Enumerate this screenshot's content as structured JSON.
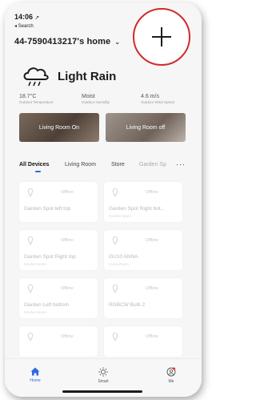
{
  "status": {
    "time": "14:06",
    "back_label": "◂ Search"
  },
  "home": {
    "title": "44-7590413217's home",
    "chevron": "⌄"
  },
  "weather": {
    "condition": "Light Rain",
    "temperature": "18.7°C",
    "temperature_label": "Outdoor Temperature",
    "humidity": "Moist",
    "humidity_label": "Outdoor Humidity",
    "wind": "4.6 m/s",
    "wind_label": "Outdoor Wind Speed"
  },
  "scenes": [
    "Living Room On",
    "Living Room off"
  ],
  "tabs": [
    "All Devices",
    "Living Room",
    "Store",
    "Garden Sp",
    "···"
  ],
  "devices": [
    {
      "status": "Offline",
      "name": "Garden Spot left top",
      "room": ""
    },
    {
      "status": "Offline",
      "name": "Garden Spot Right bot...",
      "room": "Garden Spots"
    },
    {
      "status": "Offline",
      "name": "Garden Spot Right top",
      "room": "Garden Spots"
    },
    {
      "status": "Offline",
      "name": "GU10 ANNA",
      "room": "Living Room"
    },
    {
      "status": "Offline",
      "name": "Garden Left bottom",
      "room": "Garden Spots"
    },
    {
      "status": "Offline",
      "name": "RGBCW Bulb 2",
      "room": ""
    },
    {
      "status": "Offline",
      "name": "",
      "room": ""
    },
    {
      "status": "Offline",
      "name": "",
      "room": ""
    }
  ],
  "nav": [
    "Home",
    "Smart",
    "Me"
  ],
  "colors": {
    "accent": "#2f6be0",
    "highlight_circle": "#d32a2a"
  }
}
